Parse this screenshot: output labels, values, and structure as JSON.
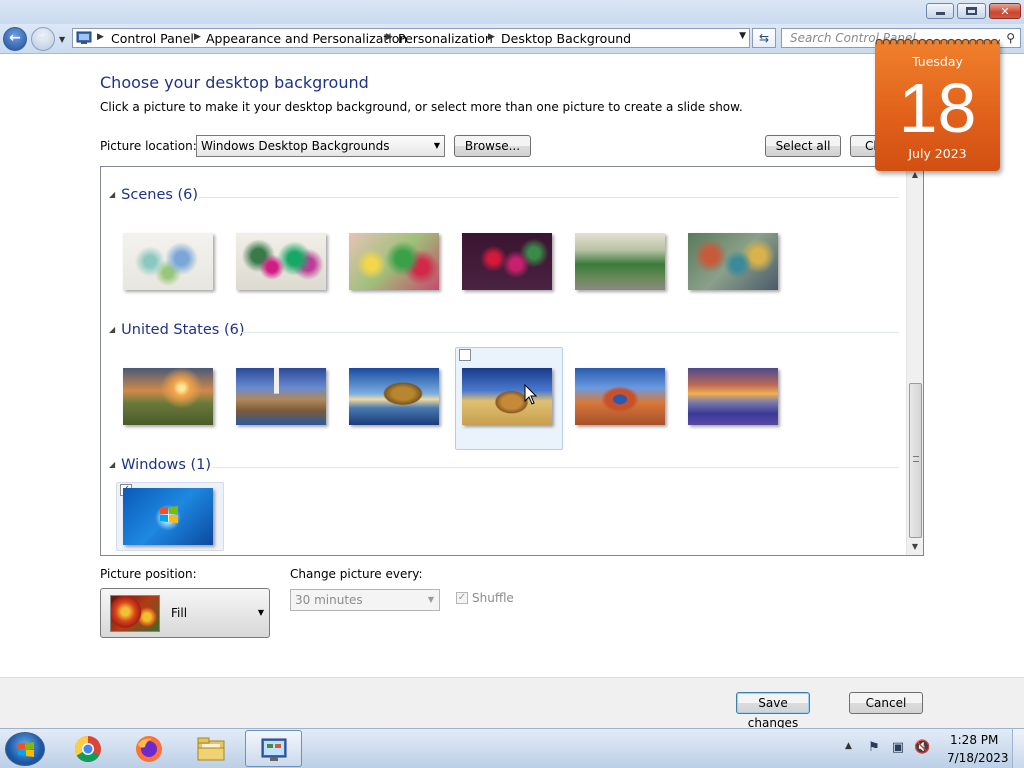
{
  "window": {
    "controls": {
      "minimize": "Minimize",
      "maximize": "Restore",
      "close": "Close"
    }
  },
  "address_bar": {
    "breadcrumbs": [
      "Control Panel",
      "Appearance and Personalization",
      "Personalization",
      "Desktop Background"
    ],
    "search_placeholder": "Search Control Panel"
  },
  "page": {
    "title": "Choose your desktop background",
    "subtitle": "Click a picture to make it your desktop background, or select more than one picture to create a slide show.",
    "picture_location_label": "Picture location:",
    "picture_location_value": "Windows Desktop Backgrounds",
    "browse_label": "Browse...",
    "select_all_label": "Select all",
    "clear_all_label": "Clear all"
  },
  "gallery": {
    "groups": [
      {
        "title": "Scenes (6)",
        "count": 6
      },
      {
        "title": "United States (6)",
        "count": 6,
        "hovered_index": 3
      },
      {
        "title": "Windows (1)",
        "count": 1,
        "selected_index": 0
      }
    ]
  },
  "options": {
    "picture_position_label": "Picture position:",
    "picture_position_value": "Fill",
    "change_every_label": "Change picture every:",
    "change_every_value": "30 minutes",
    "shuffle_label": "Shuffle",
    "shuffle_checked": true,
    "shuffle_enabled": false
  },
  "footer": {
    "save_label": "Save changes",
    "cancel_label": "Cancel"
  },
  "calendar_gadget": {
    "weekday": "Tuesday",
    "day": "18",
    "month_year": "July 2023"
  },
  "taskbar": {
    "apps": [
      "chrome-icon",
      "firefox-icon",
      "file-explorer-icon",
      "control-panel-icon"
    ],
    "active_app": "control-panel-icon",
    "clock_time": "1:28 PM",
    "clock_date": "7/18/2023"
  },
  "colors": {
    "heading": "#1e3287",
    "gadget_orange": "#e0601a",
    "selection_frame": "#eaf2fc"
  }
}
